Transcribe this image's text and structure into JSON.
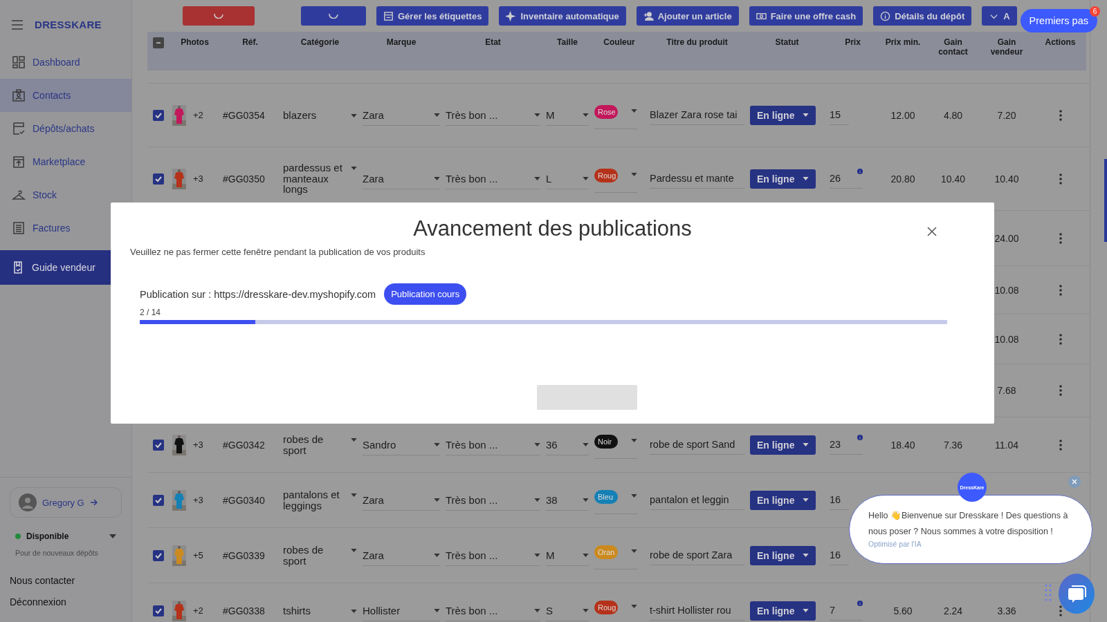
{
  "sidebar": {
    "brand": "DRESSKARE",
    "items": [
      {
        "label": "Dashboard",
        "selected": false,
        "hovered": false
      },
      {
        "label": "Contacts",
        "selected": false,
        "hovered": true
      },
      {
        "label": "Dépôts/achats",
        "selected": false,
        "hovered": false
      },
      {
        "label": "Marketplace",
        "selected": false,
        "hovered": false
      },
      {
        "label": "Stock",
        "selected": false,
        "hovered": false
      },
      {
        "label": "Factures",
        "selected": false,
        "hovered": false
      },
      {
        "label": "Guide vendeur",
        "selected": true,
        "hovered": false
      }
    ],
    "user": {
      "name": "Gregory G"
    },
    "availability": {
      "label": "Disponible",
      "note": "Pour de nouveaux dépôts",
      "color": "#238a3c"
    },
    "links": [
      "Nous contacter",
      "Déconnexion"
    ]
  },
  "toolbar": {
    "buttons": [
      {
        "kind": "loading",
        "color": "#a83232"
      },
      {
        "kind": "loading",
        "color": "#2f3c9e"
      },
      {
        "kind": "label",
        "label": "Gérer les étiquettes"
      },
      {
        "kind": "label",
        "label": "Inventaire automatique"
      },
      {
        "kind": "label",
        "label": "Ajouter un article"
      },
      {
        "kind": "label",
        "label": "Faire une offre cash"
      },
      {
        "kind": "label",
        "label": "Détails du dépôt"
      },
      {
        "kind": "label",
        "label": "A"
      }
    ]
  },
  "guide": {
    "label": "Premiers pas",
    "count": "6"
  },
  "table": {
    "select_all": {
      "indeterminate": true
    },
    "columns": [
      "Photos",
      "Réf.",
      "Catégorie",
      "Marque",
      "Etat",
      "Taille",
      "Couleur",
      "Titre du produit",
      "Statut",
      "Prix",
      "Prix min.",
      "Gain contact",
      "Gain vendeur",
      "Actions"
    ],
    "rows": [
      {
        "kind": "full",
        "checked": true,
        "photo_count": "+2",
        "ref": "#GG0354",
        "category": "blazers",
        "brand": "Zara",
        "condition": "Très bon ...",
        "size": "M",
        "color_label": "Rose",
        "color": "#c2185b",
        "title": "Blazer Zara rose tai",
        "status": "En ligne",
        "price": "15",
        "info": false,
        "min_price": "12.00",
        "gain_contact": "4.80",
        "gain_seller": "7.20"
      },
      {
        "kind": "full",
        "checked": true,
        "photo_count": "+3",
        "ref": "#GG0350",
        "category": "pardessus et manteaux longs",
        "brand": "Zara",
        "condition": "Très bon ...",
        "size": "L",
        "color_label": "Roug",
        "color": "#b5321a",
        "title": "Pardessu et mante",
        "status": "En ligne",
        "price": "26",
        "info": true,
        "min_price": "20.80",
        "gain_contact": "10.40",
        "gain_seller": "10.40"
      },
      {
        "kind": "covered",
        "gain_seller": "24.00"
      },
      {
        "kind": "covered",
        "gain_seller": "10.08"
      },
      {
        "kind": "covered",
        "gain_seller": "10.08"
      },
      {
        "kind": "covered",
        "gain_seller": "7.68"
      },
      {
        "kind": "full",
        "checked": true,
        "photo_count": "+3",
        "ref": "#GG0342",
        "category": "robes de sport",
        "brand": "Sandro",
        "condition": "Très bon ...",
        "size": "36",
        "color_label": "Noir",
        "color": "#111111",
        "title": "robe de sport Sand",
        "status": "En ligne",
        "price": "23",
        "info": true,
        "min_price": "18.40",
        "gain_contact": "7.36",
        "gain_seller": "11.04"
      },
      {
        "kind": "partial",
        "checked": true,
        "photo_count": "+3",
        "ref": "#GG0340",
        "category": "pantalons et leggings",
        "brand": "Zara",
        "condition": "Très bon ...",
        "size": "38",
        "color_label": "Bleu",
        "color": "#1580b5",
        "title": "pantalon et leggin",
        "status": "En ligne",
        "price": "16",
        "info": false
      },
      {
        "kind": "partial",
        "checked": true,
        "photo_count": "+5",
        "ref": "#GG0339",
        "category": "robes de sport",
        "brand": "Zara",
        "condition": "Très bon ...",
        "size": "M",
        "color_label": "Oran",
        "color": "#cc8a1e",
        "title": "robe de sport Zara",
        "status": "En ligne",
        "price": "16",
        "info": false
      },
      {
        "kind": "full",
        "checked": true,
        "photo_count": "+2",
        "ref": "#GG0338",
        "category": "tshirts",
        "brand": "Hollister",
        "condition": "Très bon ...",
        "size": "S",
        "color_label": "Roug",
        "color": "#b5321a",
        "title": "t-shirt Hollister rou",
        "status": "En ligne",
        "price": "7",
        "info": true,
        "min_price": "5.60",
        "gain_contact": "2.24",
        "gain_seller": "3.36"
      }
    ]
  },
  "modal": {
    "title": "Avancement des publications",
    "subtitle": "Veuillez ne pas fermer cette fenêtre pendant la publication de vos produits",
    "target": "Publication sur : https://dresskare-dev.myshopify.com",
    "badge": "Publication cours",
    "count": "2 / 14",
    "level": 0.143
  },
  "chat": {
    "avatar": "DressKare",
    "message": "Hello 👋Bienvenue sur Dresskare ! Des questions à nous poser ? Nous sommes à votre disposition !",
    "footnote": "Optimisé par l'IA"
  }
}
